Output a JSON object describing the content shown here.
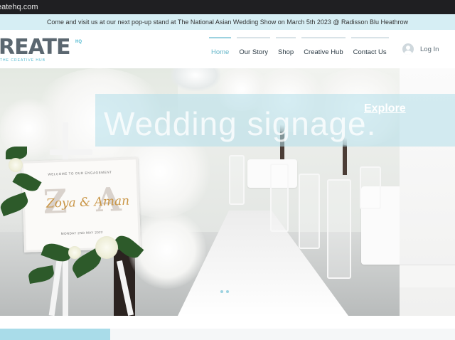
{
  "browser": {
    "url_fragment": "eatehq.com"
  },
  "announcement": {
    "text": "Come and visit us at our next pop-up stand at The National Asian Wedding Show on March 5th 2023 @ Radisson Blu Heathrow"
  },
  "logo": {
    "main": "REATE",
    "hq": "HQ",
    "sub": "THE CREATIVE HUB"
  },
  "nav": {
    "items": [
      {
        "label": "Home",
        "active": true
      },
      {
        "label": "Our Story",
        "active": false
      },
      {
        "label": "Shop",
        "active": false
      },
      {
        "label": "Creative Hub",
        "active": false
      },
      {
        "label": "Contact Us",
        "active": false
      }
    ],
    "login_label": "Log In"
  },
  "hero": {
    "title": "Wedding signage.",
    "cta": "Explore",
    "sign": {
      "top_text": "WELCOME TO OUR ENGAGEMENT",
      "monogram_left": "Z",
      "monogram_right": "A",
      "script_text": "Zoya & Aman",
      "date_text": "MONDAY 2ND MAY 2022"
    },
    "slide_count": 2
  },
  "colors": {
    "accent": "#9cd2e0",
    "announcement_bg": "#d6eef4",
    "topbar_bg": "#1f1f22",
    "nav_active": "#66b6c9",
    "text_dark": "#2b3a44"
  },
  "icons": {
    "login": "user-avatar-icon"
  }
}
